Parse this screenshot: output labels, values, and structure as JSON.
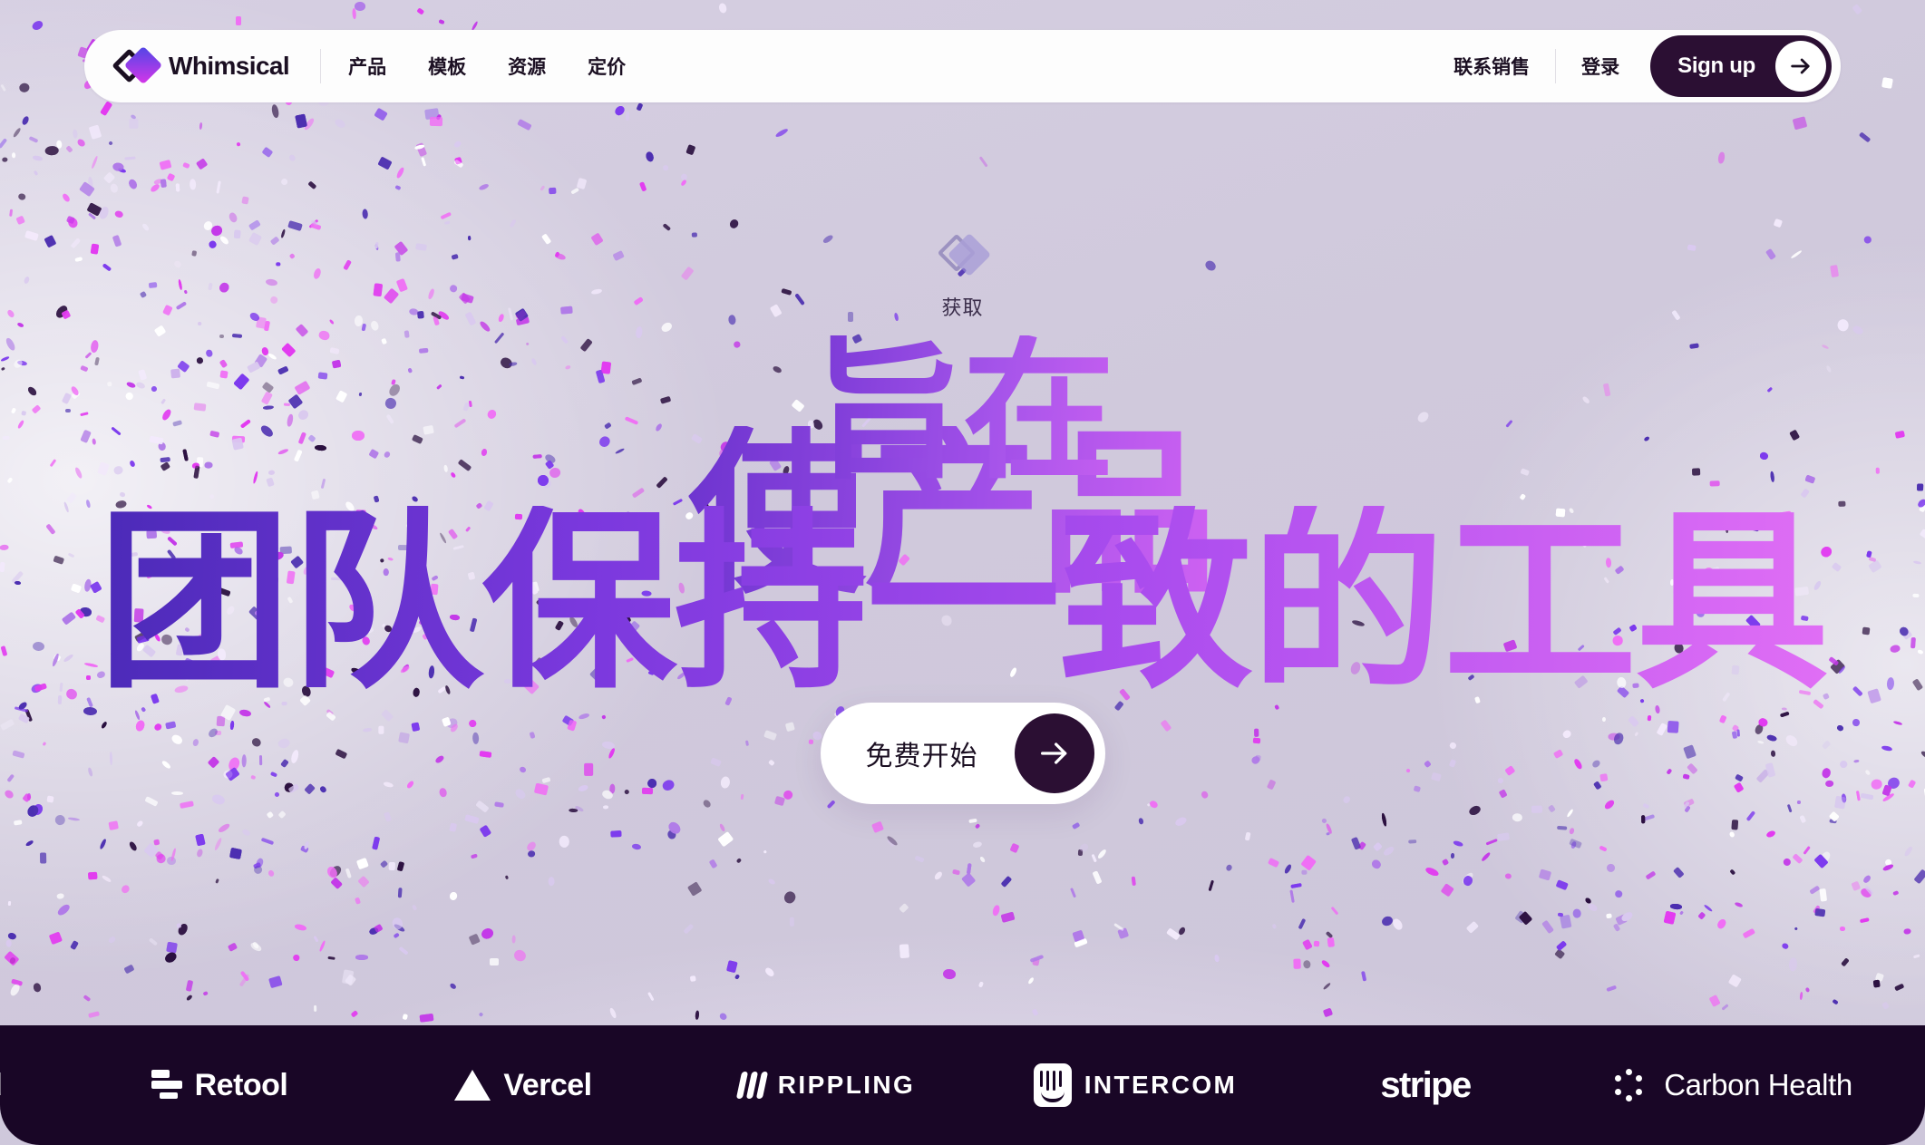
{
  "colors": {
    "page_background": "#d0c9dc",
    "nav_background": "#fdfdfd",
    "ink": "#1b0f22",
    "signup_background": "#2b0f33",
    "logobar_background": "#190626",
    "headline_gradient_start": "#4b2ab8",
    "headline_gradient_end": "#e06ef5",
    "brand_gradient_start": "#4f46e5",
    "brand_gradient_end": "#d936e8"
  },
  "nav": {
    "brand_name": "Whimsical",
    "links": [
      {
        "label": "产品"
      },
      {
        "label": "模板"
      },
      {
        "label": "资源"
      },
      {
        "label": "定价"
      }
    ],
    "contact_sales": "联系销售",
    "login": "登录",
    "signup": "Sign up"
  },
  "hero": {
    "eyebrow": "获取",
    "headline_line_1": "旨在",
    "headline_line_2": "使产品",
    "headline_line_3": "团队保持一致的工具",
    "cta_label": "免费开始"
  },
  "logobar": {
    "clipped_left": "d",
    "logos": [
      {
        "name": "Retool",
        "mark": "retool-bars-icon"
      },
      {
        "name": "Vercel",
        "mark": "vercel-triangle-icon"
      },
      {
        "name": "RIPPLING",
        "mark": "rippling-waves-icon"
      },
      {
        "name": "INTERCOM",
        "mark": "intercom-face-icon"
      },
      {
        "name": "stripe",
        "mark": "stripe-wordmark"
      },
      {
        "name": "Carbon Health",
        "mark": "carbon-health-dots-icon"
      }
    ]
  }
}
